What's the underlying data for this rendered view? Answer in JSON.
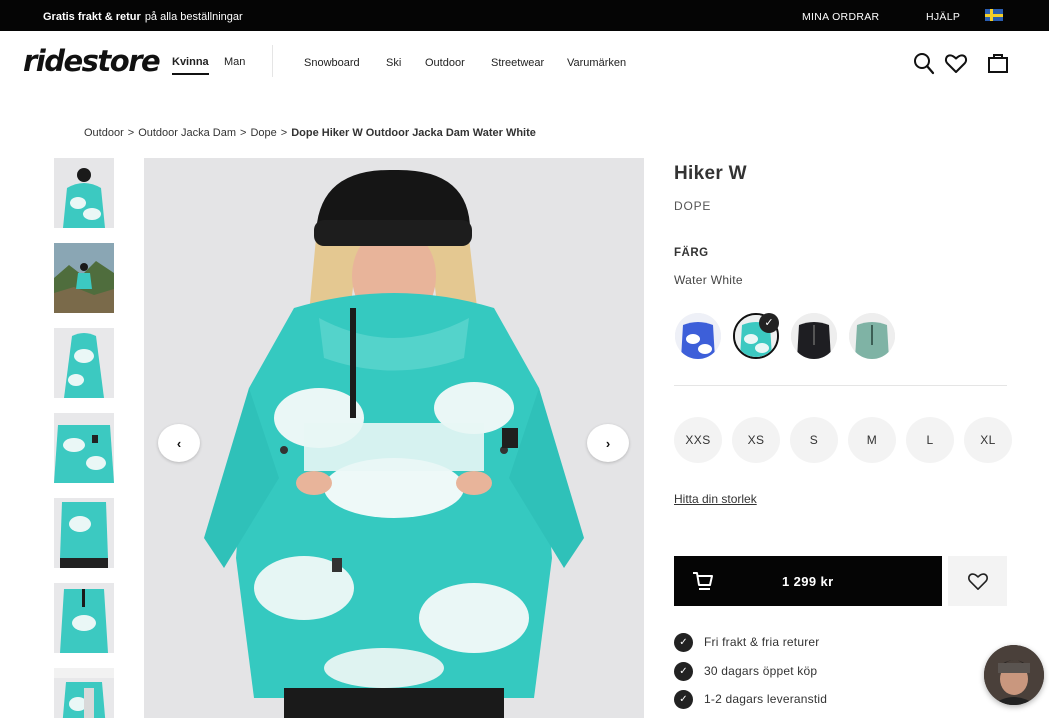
{
  "topbar": {
    "promo_bold": "Gratis frakt & retur",
    "promo_text": "på alla beställningar",
    "orders": "MINA ORDRAR",
    "help": "HJÄLP",
    "flag_icon": "sweden-flag-icon"
  },
  "header": {
    "logo": "ridestore",
    "genders": [
      "Kvinna",
      "Man"
    ],
    "categories": [
      "Snowboard",
      "Ski",
      "Outdoor",
      "Streetwear",
      "Varumärken"
    ],
    "icons": [
      "search-icon",
      "heart-icon",
      "bag-icon"
    ]
  },
  "breadcrumb": {
    "items": [
      "Outdoor",
      "Outdoor Jacka Dam",
      "Dope"
    ],
    "current": "Dope Hiker W Outdoor Jacka Dam Water White",
    "separator": ">"
  },
  "gallery": {
    "thumbnail_count": 7,
    "prev_icon": "chevron-left-icon",
    "next_icon": "chevron-right-icon",
    "jacket_colors": {
      "teal": "#2fc7c0",
      "white": "#eaf7f6",
      "hat": "#1a1a1a"
    }
  },
  "product": {
    "title": "Hiker W",
    "brand": "DOPE",
    "color_label": "FÄRG",
    "color_value": "Water White",
    "swatches": [
      "Blue Tie Dye",
      "Water White",
      "Black",
      "Green"
    ],
    "selected_swatch": 1,
    "sizes": [
      "XXS",
      "XS",
      "S",
      "M",
      "L",
      "XL"
    ],
    "find_size": "Hitta din storlek",
    "price": "1 299 kr",
    "features": [
      "Fri frakt & fria returer",
      "30 dagars öppet köp",
      "1-2 dagars leveranstid"
    ],
    "accent": "#050505"
  }
}
